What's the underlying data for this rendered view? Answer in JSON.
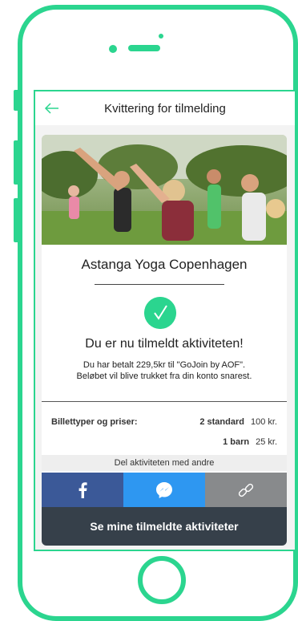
{
  "nav": {
    "title": "Kvittering for tilmelding"
  },
  "activity": {
    "title": "Astanga Yoga Copenhagen"
  },
  "confirmation": {
    "title": "Du er nu tilmeldt aktiviteten!",
    "line1": "Du har betalt 229,5kr til \"GoJoin by AOF\".",
    "line2": "Beløbet vil blive trukket fra din konto snarest."
  },
  "tickets": {
    "label": "Billettyper og priser:",
    "rows": [
      {
        "qty": "2 standard",
        "price": "100 kr."
      },
      {
        "qty": "1 barn",
        "price": "25 kr."
      }
    ]
  },
  "share": {
    "label": "Del aktiviteten med andre",
    "buttons": [
      {
        "icon": "facebook-icon",
        "color": "#3b5998"
      },
      {
        "icon": "messenger-icon",
        "color": "#2e97f1"
      },
      {
        "icon": "link-icon",
        "color": "#888a8c"
      }
    ]
  },
  "cta": {
    "label": "Se mine tilmeldte aktiviteter"
  },
  "colors": {
    "brand": "#2bd58f",
    "cta_bg": "#36404a"
  }
}
